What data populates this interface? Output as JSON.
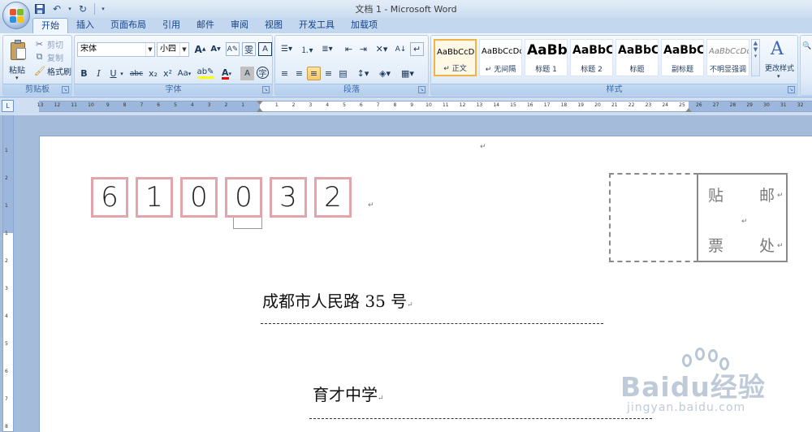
{
  "window": {
    "title": "文档 1 - Microsoft Word"
  },
  "tabs": [
    "开始",
    "插入",
    "页面布局",
    "引用",
    "邮件",
    "审阅",
    "视图",
    "开发工具",
    "加载项"
  ],
  "clipboard": {
    "paste": "粘贴",
    "cut": "剪切",
    "copy": "复制",
    "format_painter": "格式刷",
    "label": "剪贴板"
  },
  "font": {
    "name": "宋体",
    "size": "小四",
    "label": "字体",
    "grow": "A",
    "shrink": "A",
    "bold": "B",
    "italic": "I",
    "underline": "U",
    "strike": "abc",
    "subscript": "x₂",
    "superscript": "x²",
    "change_case": "Aa"
  },
  "paragraph": {
    "label": "段落"
  },
  "styles": {
    "label": "样式",
    "change_styles": "更改样式",
    "items": [
      {
        "sample": "AaBbCcDd",
        "name": "↵ 正文"
      },
      {
        "sample": "AaBbCcDd",
        "name": "↵ 无间隔"
      },
      {
        "sample": "AaBb",
        "name": "标题 1"
      },
      {
        "sample": "AaBbC",
        "name": "标题 2"
      },
      {
        "sample": "AaBbC",
        "name": "标题"
      },
      {
        "sample": "AaBbC",
        "name": "副标题"
      },
      {
        "sample": "AaBbCcDd",
        "name": "不明显强调"
      }
    ]
  },
  "ruler": {
    "left_ticks": [
      "13",
      "12",
      "11",
      "10",
      "9",
      "8",
      "7",
      "6",
      "5",
      "4",
      "3",
      "2",
      "1"
    ],
    "right_ticks": [
      "1",
      "2",
      "3",
      "4",
      "5",
      "6",
      "7",
      "8",
      "9",
      "10",
      "11",
      "12",
      "13",
      "14",
      "15",
      "16",
      "17",
      "18",
      "19",
      "20",
      "21",
      "22",
      "23",
      "24",
      "25",
      "26",
      "27",
      "28",
      "29",
      "30",
      "31",
      "32"
    ],
    "vertical_ticks": [
      "1",
      "2",
      "1",
      "1",
      "2",
      "3",
      "4",
      "5",
      "6",
      "7",
      "8"
    ]
  },
  "document": {
    "postal_code": [
      "6",
      "1",
      "0",
      "0",
      "3",
      "2"
    ],
    "stamp_area": {
      "chars": [
        "贴",
        "邮",
        "票",
        "处"
      ]
    },
    "address": "成都市人民路 35 号",
    "recipient": "育才中学",
    "para_mark": "↵"
  },
  "watermark": {
    "brand": "Baidu经验",
    "url": "jingyan.baidu.com"
  },
  "colors": {
    "zip_border": "#e3a5ac",
    "ribbon_bg": "#dde9f7",
    "doc_bg": "#a4bcd9",
    "highlight_yellow": "#ffff00",
    "font_red": "#ff0000"
  }
}
